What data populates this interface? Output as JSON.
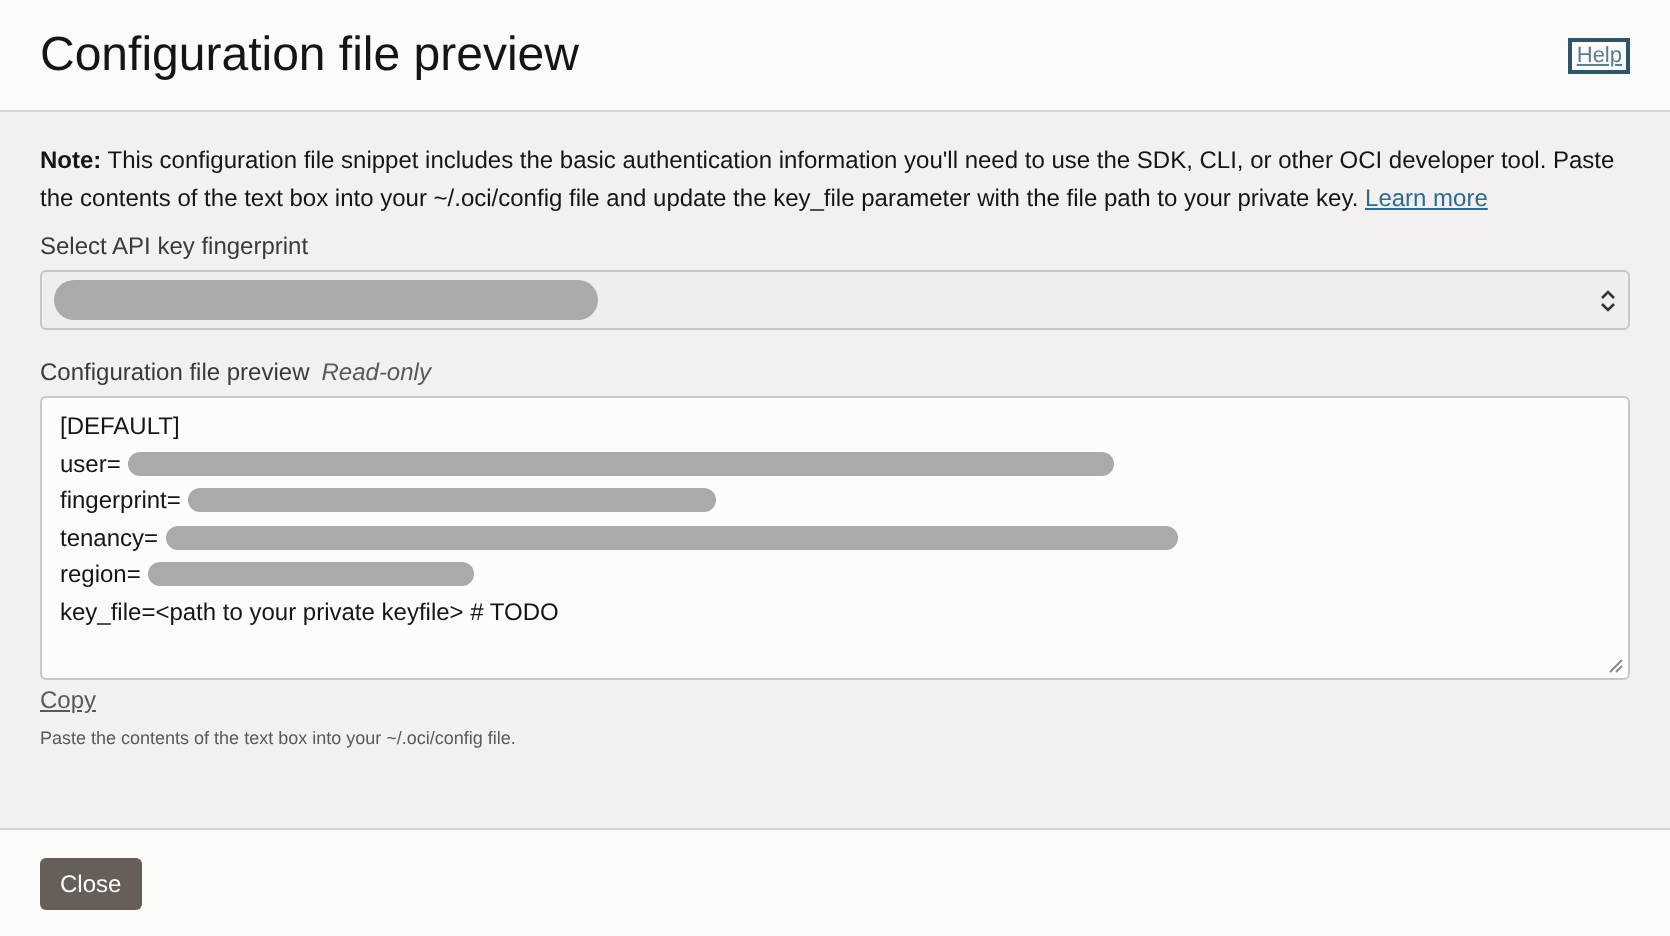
{
  "dialog": {
    "title": "Configuration file preview",
    "help_link": "Help"
  },
  "note": {
    "text": "**Note:** This configuration file snippet includes the basic authentication information you'll need to use the SDK, CLI, or other OCI developer tool. Paste the contents of the text box into your ~/.oci/config file and update the key_file parameter with the file path to your private key.",
    "link": "Learn more"
  },
  "fingerprint_select": {
    "label": "Select API key fingerprint",
    "value_redacted": true
  },
  "preview": {
    "label": "Configuration file preview",
    "hint": "Read-only",
    "lines": [
      {
        "kind": "text",
        "text": "[DEFAULT]"
      },
      {
        "kind": "redacted",
        "text": "user="
      },
      {
        "kind": "redacted",
        "text": "fingerprint="
      },
      {
        "kind": "redacted",
        "text": "tenancy="
      },
      {
        "kind": "redacted",
        "text": "region="
      },
      {
        "kind": "text",
        "text": "key_file=<path to your private keyfile> # TODO"
      }
    ]
  },
  "copy_link": "Copy",
  "helper_text": "Paste the contents of the text box into your ~/.oci/config file.",
  "buttons": [
    "Close"
  ]
}
